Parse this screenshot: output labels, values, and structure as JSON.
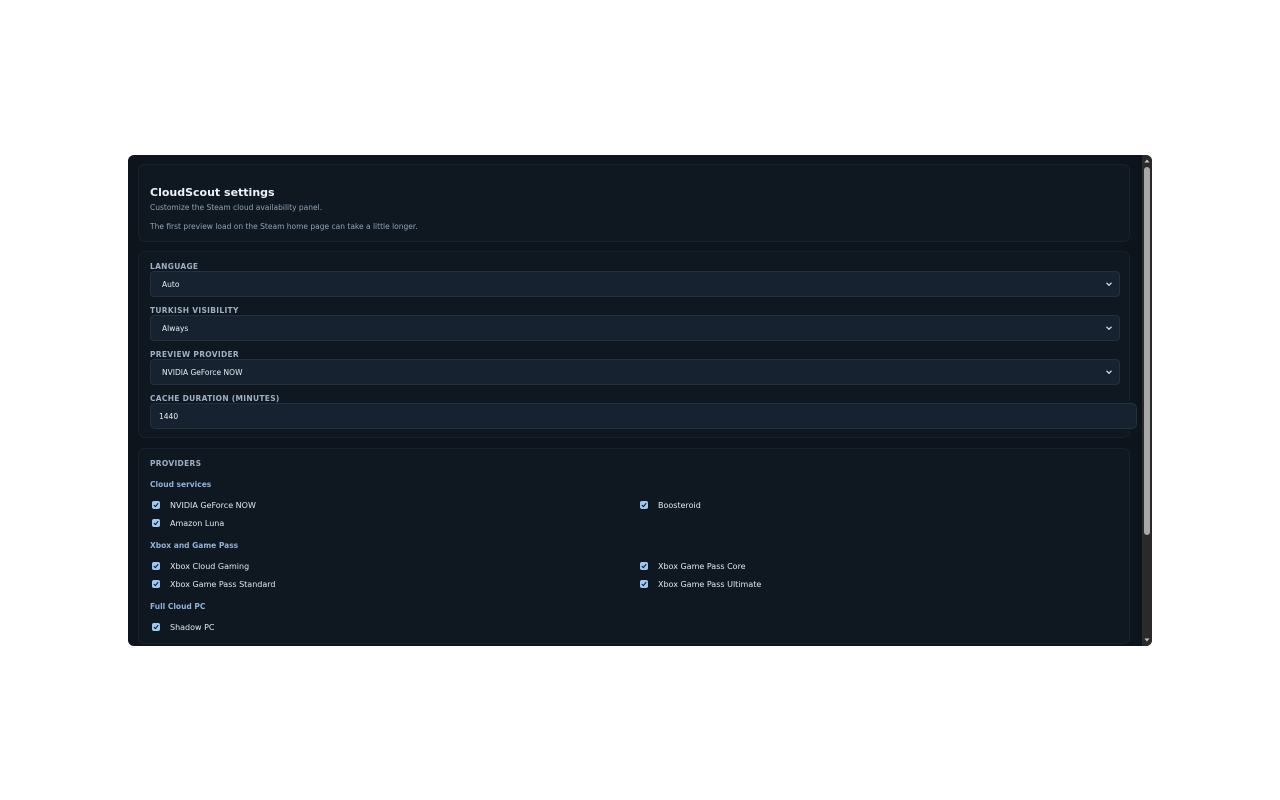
{
  "header": {
    "title": "CloudScout settings",
    "subtitle": "Customize the Steam cloud availability panel.",
    "note": "The first preview load on the Steam home page can take a little longer."
  },
  "form": {
    "language": {
      "label": "LANGUAGE",
      "value": "Auto"
    },
    "turkish_visibility": {
      "label": "TURKISH VISIBILITY",
      "value": "Always"
    },
    "preview_provider": {
      "label": "PREVIEW PROVIDER",
      "value": "NVIDIA GeForce NOW"
    },
    "cache_duration": {
      "label": "CACHE DURATION (MINUTES)",
      "value": "1440"
    }
  },
  "providers": {
    "title": "PROVIDERS",
    "groups": [
      {
        "title": "Cloud services",
        "items": [
          {
            "label": "NVIDIA GeForce NOW",
            "checked": true
          },
          {
            "label": "Boosteroid",
            "checked": true
          },
          {
            "label": "Amazon Luna",
            "checked": true
          }
        ]
      },
      {
        "title": "Xbox and Game Pass",
        "items": [
          {
            "label": "Xbox Cloud Gaming",
            "checked": true
          },
          {
            "label": "Xbox Game Pass Core",
            "checked": true
          },
          {
            "label": "Xbox Game Pass Standard",
            "checked": true
          },
          {
            "label": "Xbox Game Pass Ultimate",
            "checked": true
          }
        ]
      },
      {
        "title": "Full Cloud PC",
        "items": [
          {
            "label": "Shadow PC",
            "checked": true
          }
        ]
      }
    ]
  },
  "colors": {
    "background": "#0e141c",
    "card": "#0f1720",
    "field": "#172230",
    "checkbox": "#9cc8f2",
    "group_title": "#8fb3d8"
  },
  "icons": {
    "select_arrow": "chevron-down-icon",
    "checkbox_mark": "check-icon"
  }
}
